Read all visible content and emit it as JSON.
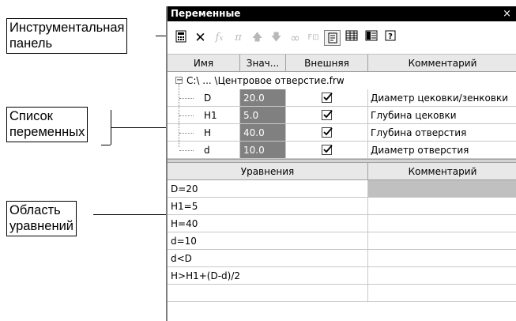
{
  "callouts": {
    "toolbar": [
      "Инструментальная",
      "панель"
    ],
    "variables": [
      "Список",
      "переменных"
    ],
    "equations": [
      "Область",
      "уравнений"
    ]
  },
  "window": {
    "title": "Переменные",
    "close_glyph": "×"
  },
  "toolbar": {
    "buttons": [
      {
        "icon": "calculator-icon",
        "glyph": "▦",
        "enabled": true
      },
      {
        "icon": "delete-x-icon",
        "glyph": "✕",
        "enabled": true
      },
      {
        "icon": "function-fx-icon",
        "glyph": "fx",
        "enabled": false
      },
      {
        "icon": "pi-constant-icon",
        "glyph": "π",
        "enabled": false
      },
      {
        "icon": "move-up-icon",
        "glyph": "↑",
        "enabled": false
      },
      {
        "icon": "move-down-icon",
        "glyph": "↓",
        "enabled": false
      },
      {
        "icon": "link-icon",
        "glyph": "∞",
        "enabled": false
      },
      {
        "icon": "fragment-icon",
        "glyph": "⊡",
        "enabled": false
      },
      {
        "icon": "text-view-icon",
        "glyph": "▣",
        "enabled": true,
        "pressed": true
      },
      {
        "icon": "table-view-icon",
        "glyph": "▤",
        "enabled": true
      },
      {
        "icon": "list-view-icon",
        "glyph": "▥",
        "enabled": true
      },
      {
        "icon": "help-icon",
        "glyph": "?",
        "enabled": true
      }
    ]
  },
  "variables": {
    "headers": {
      "name": "Имя",
      "value": "Знач...",
      "external": "Внешняя",
      "comment": "Комментарий"
    },
    "file_node": "C:\\ ... \\Центровое отверстие.frw",
    "rows": [
      {
        "name": "D",
        "value": "20.0",
        "external": true,
        "comment": "Диаметр цековки/зенковки"
      },
      {
        "name": "H1",
        "value": "5.0",
        "external": true,
        "comment": "Глубина цековки"
      },
      {
        "name": "H",
        "value": "40.0",
        "external": true,
        "comment": "Глубина отверстия"
      },
      {
        "name": "d",
        "value": "10.0",
        "external": true,
        "comment": "Диаметр отверстия"
      }
    ]
  },
  "equations": {
    "headers": {
      "equation": "Уравнения",
      "comment": "Комментарий"
    },
    "rows": [
      {
        "equation": "D=20",
        "comment": ""
      },
      {
        "equation": "H1=5",
        "comment": ""
      },
      {
        "equation": "H=40",
        "comment": ""
      },
      {
        "equation": "d=10",
        "comment": ""
      },
      {
        "equation": "d<D",
        "comment": ""
      },
      {
        "equation": "H>H1+(D-d)/2",
        "comment": ""
      },
      {
        "equation": "",
        "comment": ""
      }
    ]
  },
  "colors": {
    "value_cell_bg": "#808080",
    "selected_comment_bg": "#c0c0c0",
    "titlebar_bg": "#000000"
  }
}
